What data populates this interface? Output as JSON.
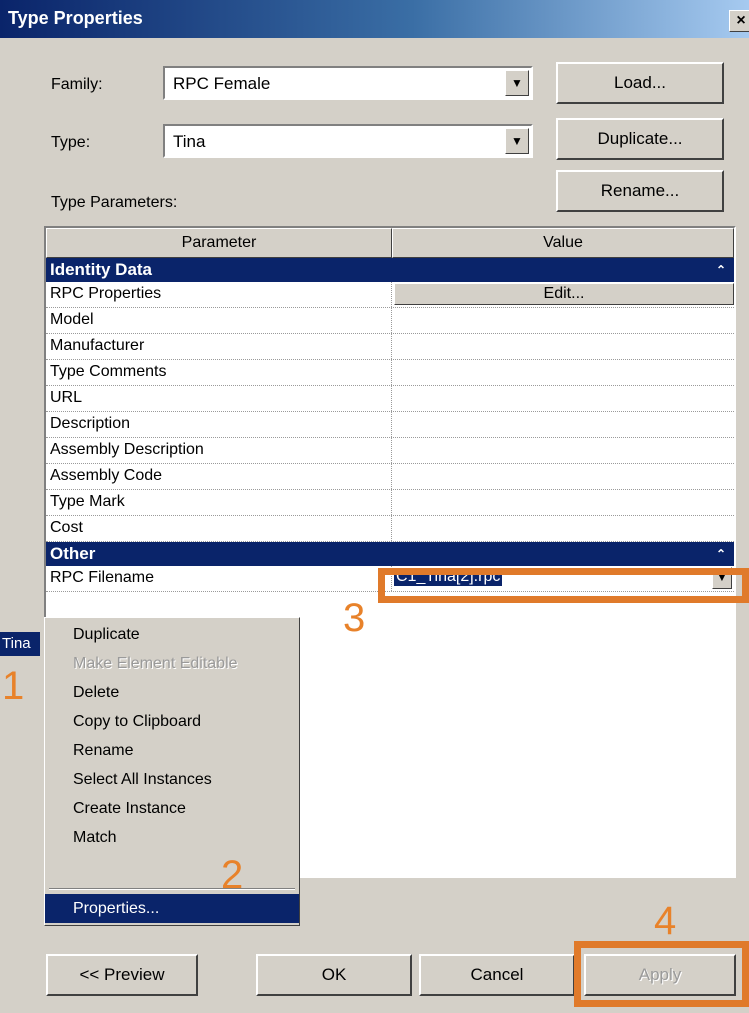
{
  "window": {
    "title": "Type Properties",
    "close_glyph": "×"
  },
  "family": {
    "label": "Family:",
    "value": "RPC Female"
  },
  "type": {
    "label": "Type:",
    "value": "Tina"
  },
  "buttons": {
    "load": "Load...",
    "duplicate": "Duplicate...",
    "rename": "Rename..."
  },
  "type_parameters_label": "Type Parameters:",
  "grid": {
    "headers": {
      "parameter": "Parameter",
      "value": "Value"
    },
    "categories": [
      {
        "name": "Identity Data",
        "rows": [
          {
            "name": "RPC Properties",
            "value": "Edit..."
          },
          {
            "name": "Model",
            "value": ""
          },
          {
            "name": "Manufacturer",
            "value": ""
          },
          {
            "name": "Type Comments",
            "value": ""
          },
          {
            "name": "URL",
            "value": ""
          },
          {
            "name": "Description",
            "value": ""
          },
          {
            "name": "Assembly Description",
            "value": ""
          },
          {
            "name": "Assembly Code",
            "value": ""
          },
          {
            "name": "Type Mark",
            "value": ""
          },
          {
            "name": "Cost",
            "value": ""
          }
        ]
      },
      {
        "name": "Other",
        "rows": [
          {
            "name": "RPC Filename",
            "value": "C1_Tina[2].rpc"
          }
        ]
      }
    ]
  },
  "tree_selected_item": "Tina",
  "context_menu": {
    "items": [
      {
        "label": "Duplicate"
      },
      {
        "label": "Make Element Editable"
      },
      {
        "label": "Delete"
      },
      {
        "label": "Copy to Clipboard"
      },
      {
        "label": "Rename"
      },
      {
        "label": "Select All Instances"
      },
      {
        "label": "Create Instance"
      },
      {
        "label": "Match"
      },
      {
        "label": "Properties..."
      }
    ]
  },
  "annotations": {
    "step1": "1",
    "step2": "2",
    "step3": "3",
    "step4": "4"
  },
  "bottom_buttons": {
    "preview": "<< Preview",
    "ok": "OK",
    "cancel": "Cancel",
    "apply": "Apply"
  },
  "colors": {
    "highlight": "#0a246a",
    "annotation": "#e07a2a",
    "dialog_bg": "#d4d0c8"
  }
}
